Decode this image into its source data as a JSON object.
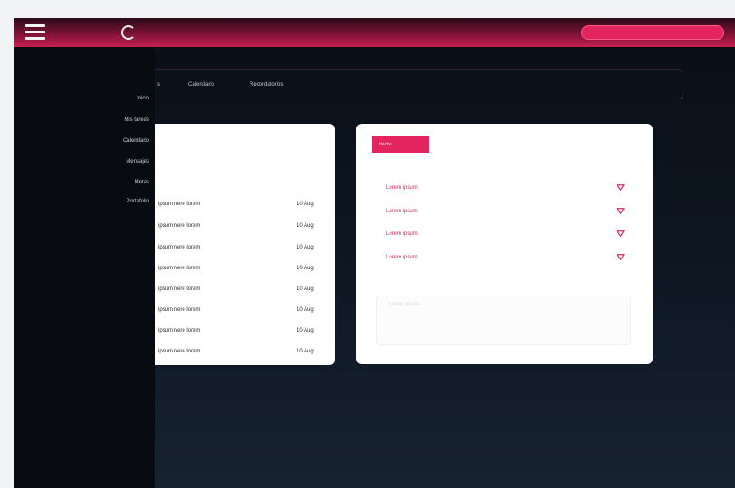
{
  "topbar": {
    "logo_text": "",
    "accent_color": "#c81e52"
  },
  "sidebar": {
    "items": [
      {
        "label": "Inicio"
      },
      {
        "label": "Mis tareas"
      },
      {
        "label": "Calendario"
      },
      {
        "label": "Mensajes"
      },
      {
        "label": "Metas"
      },
      {
        "label": "Portafolio"
      }
    ]
  },
  "tabs": [
    {
      "label": "s"
    },
    {
      "label": "Calendario"
    },
    {
      "label": "Recordatorios"
    }
  ],
  "list": {
    "rows": [
      {
        "text": "ipsum nere lorem",
        "date": "10 Aug"
      },
      {
        "text": "ipsum nere lorem",
        "date": "10 Aug"
      },
      {
        "text": "ipsum nere lorem",
        "date": "10 Aug"
      },
      {
        "text": "ipsum nere lorem",
        "date": "10 Aug"
      },
      {
        "text": "ipsum nere lorem",
        "date": "10 Aug"
      },
      {
        "text": "ipsum nere lorem",
        "date": "10 Aug"
      },
      {
        "text": "ipsum nere lorem",
        "date": "10 Aug"
      },
      {
        "text": "ipsum nere lorem",
        "date": "10 Aug"
      }
    ]
  },
  "panel": {
    "button_label": "Hecho",
    "items": [
      {
        "label": "Lorem ipsum"
      },
      {
        "label": "Lorem ipsum"
      },
      {
        "label": "Lorem ipsum"
      },
      {
        "label": "Lorem ipsum"
      }
    ],
    "note_placeholder": "Lorem ipsum..."
  }
}
